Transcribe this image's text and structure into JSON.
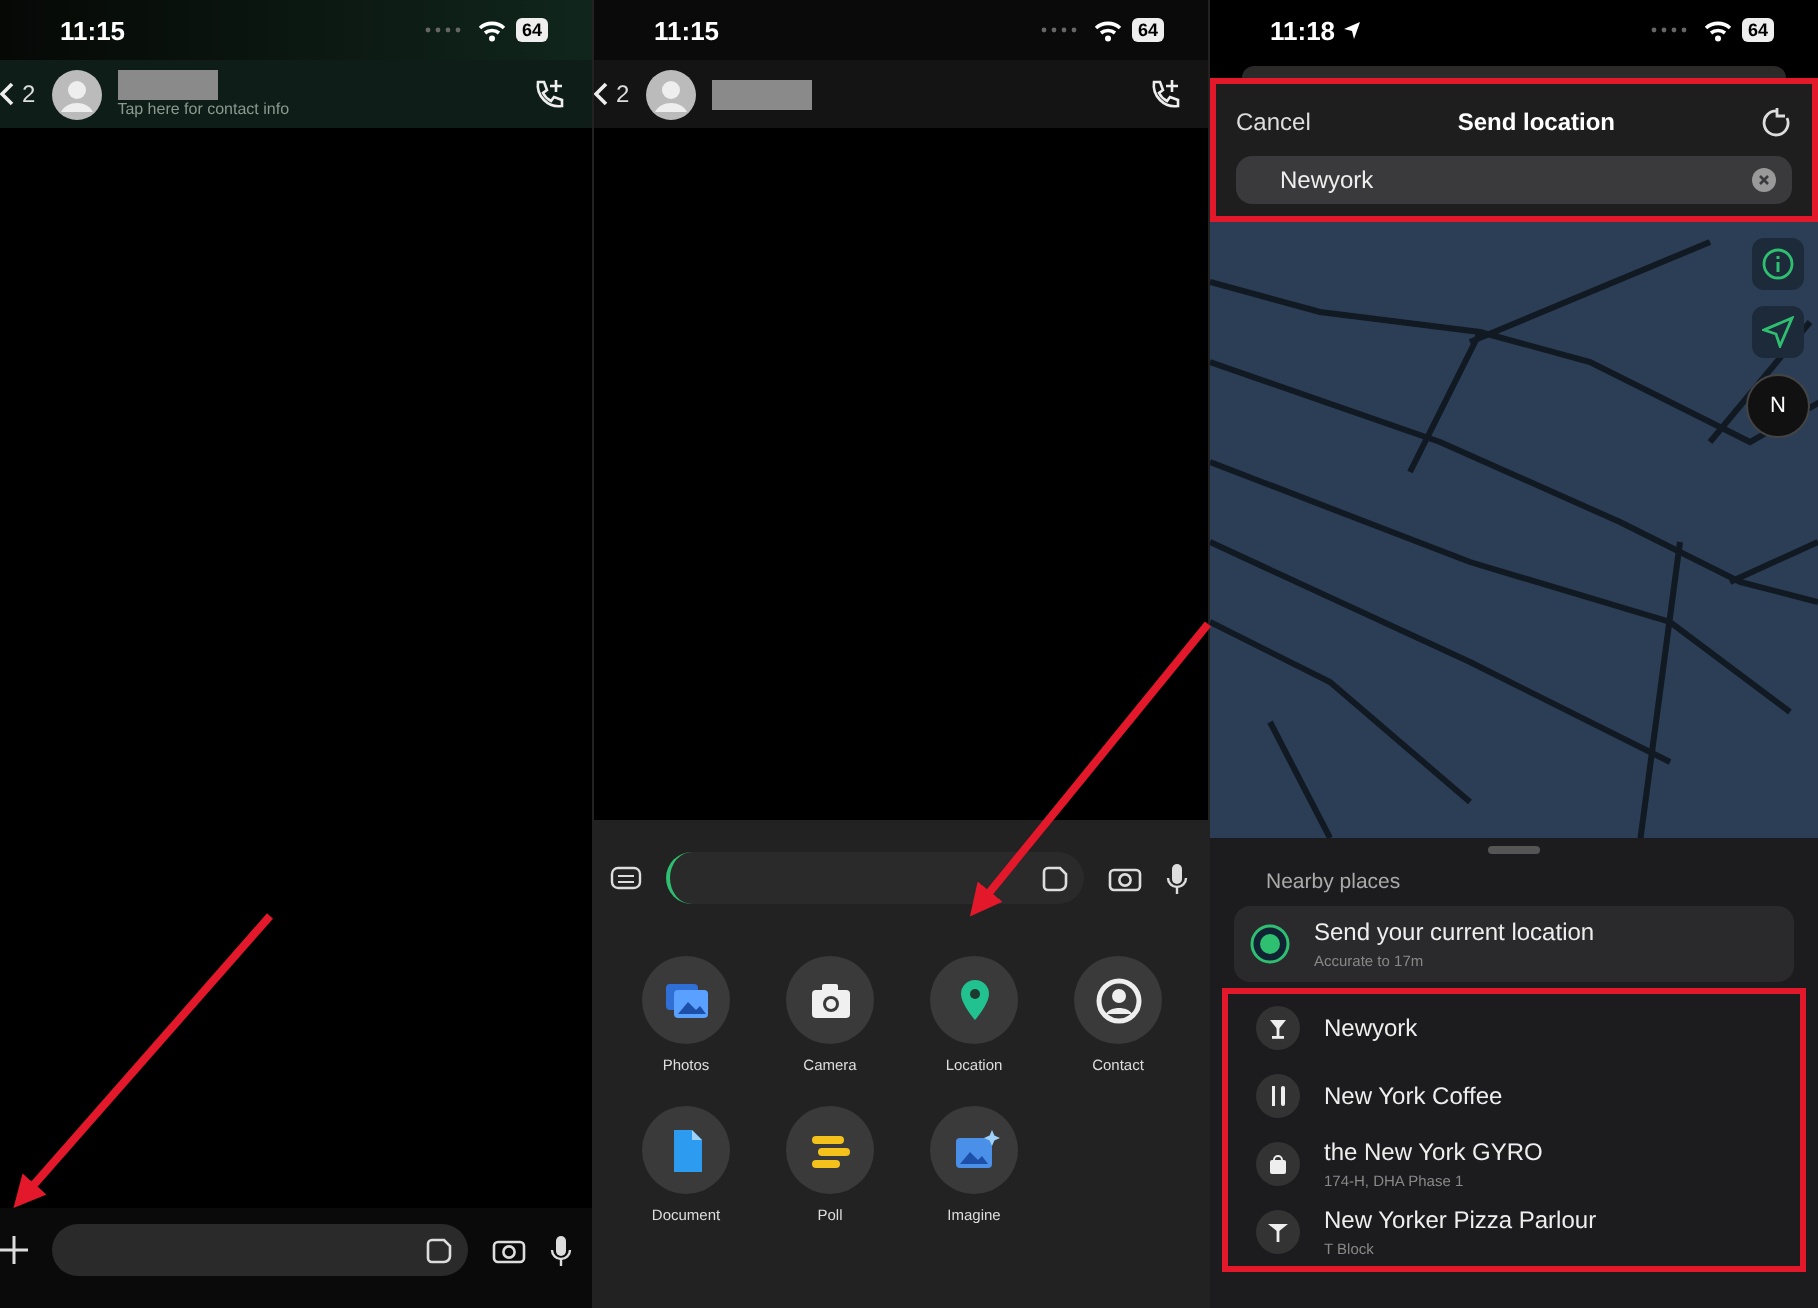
{
  "panels": [
    {
      "kind": "chat",
      "status": {
        "time": "11:15",
        "battery": "64",
        "location_arrow": false
      },
      "header": {
        "back_count": "2",
        "subtitle": "Tap here for contact info"
      }
    },
    {
      "kind": "attach",
      "status": {
        "time": "11:15",
        "battery": "64",
        "location_arrow": false
      },
      "header": {
        "back_count": "2"
      },
      "attachments": [
        {
          "label": "Photos",
          "kind": "photos"
        },
        {
          "label": "Camera",
          "kind": "camera"
        },
        {
          "label": "Location",
          "kind": "location"
        },
        {
          "label": "Contact",
          "kind": "contact"
        },
        {
          "label": "Document",
          "kind": "document"
        },
        {
          "label": "Poll",
          "kind": "poll"
        },
        {
          "label": "Imagine",
          "kind": "imagine"
        }
      ]
    },
    {
      "kind": "location",
      "status": {
        "time": "11:18",
        "battery": "64",
        "location_arrow": true
      },
      "toolbar": {
        "cancel": "Cancel",
        "title": "Send location",
        "highlighted": true
      },
      "search": {
        "value": "Newyork"
      },
      "compass": "N",
      "places_heading": "Nearby places",
      "current": {
        "title": "Send your current location",
        "subtitle": "Accurate to 17m"
      },
      "places_highlighted": true,
      "places": [
        {
          "name": "Newyork",
          "kind": "bar"
        },
        {
          "name": "New York  Coffee",
          "kind": "restaurant"
        },
        {
          "name": "the New York GYRO",
          "subtitle": "174-H, DHA Phase 1",
          "kind": "shop"
        },
        {
          "name": "New Yorker Pizza Parlour",
          "subtitle": "T Block",
          "kind": "eatery"
        }
      ]
    }
  ],
  "annotations": [
    {
      "kind": "arrow"
    },
    {
      "kind": "arrow"
    }
  ]
}
